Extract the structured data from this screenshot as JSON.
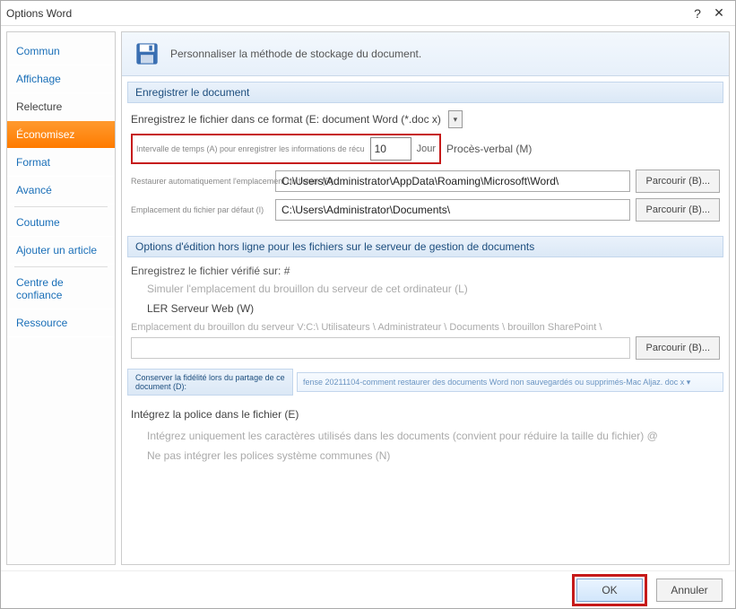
{
  "title": "Options Word",
  "titlebar": {
    "help": "?",
    "close": "✕"
  },
  "sidebar": {
    "items": [
      {
        "label": "Commun"
      },
      {
        "label": "Affichage"
      },
      {
        "label": "Relecture"
      },
      {
        "label": "Économisez"
      },
      {
        "label": "Format"
      },
      {
        "label": "Avancé"
      },
      {
        "label": "Coutume"
      },
      {
        "label": "Ajouter un article"
      },
      {
        "label": "Centre de confiance"
      },
      {
        "label": "Ressource"
      }
    ]
  },
  "banner": {
    "text": "Personnaliser la méthode de stockage du document."
  },
  "save_section": {
    "title": "Enregistrer le document",
    "format_label": "Enregistrez le fichier dans ce format (E: document Word (*.doc x)",
    "interval_label": "Intervalle de temps (A) pour enregistrer les informations de récu",
    "interval_value": "10",
    "interval_unit": "Jour",
    "minutes_label": "Procès-verbal (M)",
    "restore_label": "Restaurer automatiquement l'emplacement du fichier (R)",
    "restore_path": "C:\\Users\\Administrator\\AppData\\Roaming\\Microsoft\\Word\\",
    "default_label": "Emplacement du fichier par défaut (I)",
    "default_path": "C:\\Users\\Administrator\\Documents\\",
    "browse": "Parcourir (B)..."
  },
  "offline_section": {
    "title": "Options d'édition hors ligne pour les fichiers sur le serveur de gestion de documents",
    "checked_label": "Enregistrez le fichier vérifié sur: #",
    "mirror_label": "Simuler l'emplacement du brouillon du serveur de cet ordinateur (L)",
    "webserver_label": "LER Serveur Web (W)",
    "draft_label": "Emplacement du brouillon du serveur V:C:\\ Utilisateurs \\ Administrateur \\ Documents \\ brouillon SharePoint \\",
    "browse": "Parcourir (B)..."
  },
  "fidelity": {
    "label": "Conserver la fidélité lors du partage de ce document (D):",
    "selected": "fense 20211104-comment restaurer des documents Word non sauvegardés ou supprimés-Mac Aljaz. doc x ▾"
  },
  "font_section": {
    "embed_label": "Intégrez la police dans le fichier (E)",
    "only_used": "Intégrez uniquement les caractères utilisés dans les documents (convient pour réduire la taille du fichier) @",
    "no_system": "Ne pas intégrer les polices système communes (N)"
  },
  "footer": {
    "ok": "OK",
    "cancel": "Annuler"
  }
}
